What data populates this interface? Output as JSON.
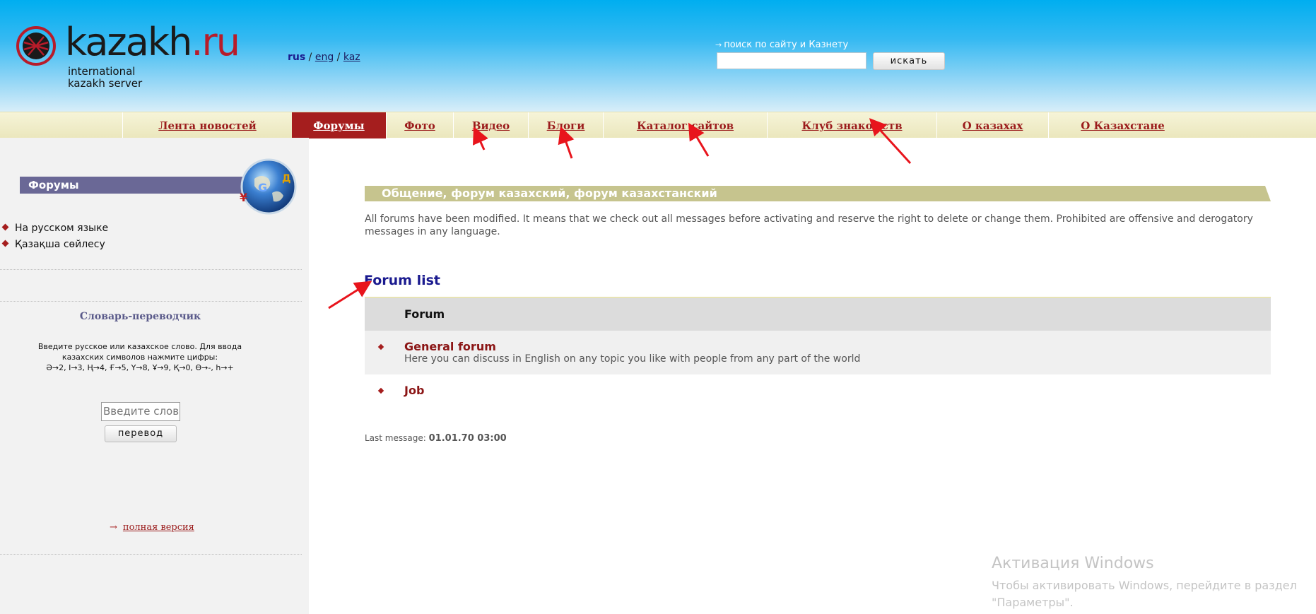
{
  "header": {
    "logo": {
      "word_main": "kazakh",
      "word_accent": ".ru",
      "subtitle_line1": "international",
      "subtitle_line2": "kazakh server"
    },
    "languages": {
      "current": "rus",
      "separator": " / ",
      "eng": "eng",
      "kaz": "kaz"
    },
    "search": {
      "label": "поиск по сайту и Казнету",
      "value": "",
      "button": "искать"
    },
    "colors": {
      "sky_top": "#00aef0",
      "sky_bottom": "#d8eef9"
    }
  },
  "nav": {
    "items": [
      {
        "label": "Лента новостей",
        "active": false
      },
      {
        "label": "Форумы",
        "active": true
      },
      {
        "label": "Фото",
        "active": false
      },
      {
        "label": "Видео",
        "active": false
      },
      {
        "label": "Блоги",
        "active": false
      },
      {
        "label": "Каталог сайтов",
        "active": false
      },
      {
        "label": "Клуб знакомств",
        "active": false
      },
      {
        "label": "О казахах",
        "active": false
      },
      {
        "label": "О Казахстане",
        "active": false
      }
    ],
    "active_color": "#a51e1e",
    "link_color": "#9b1c1c"
  },
  "sidebar": {
    "title": "Форумы",
    "links": [
      "На русском языке",
      "Қазақша сөйлесу"
    ],
    "dictionary": {
      "title": "Словарь-переводчик",
      "instructions_line1": "Введите русское или казахское слово. Для ввода",
      "instructions_line2": "казахских символов нажмите цифры:",
      "instructions_line3": "Ә→2, І→3, Ң→4, Ғ→5, Ү→8, Ұ→9, Қ→0, Ө→-, һ→+",
      "input_placeholder": "Введите слово",
      "button": "перевод"
    },
    "full_version": "полная версия"
  },
  "main": {
    "section_title": "Общение, форум казахский, форум казахстанский",
    "notice": "All forums have been modified. It means that we check out all messages before activating and reserve the right to delete or change them. Prohibited are offensive and derogatory messages in any language.",
    "forum_list_heading": "Forum list",
    "table": {
      "header": "Forum",
      "rows": [
        {
          "name": "General forum",
          "description": "Here you can discuss in English on any topic you like with people from any part of the world"
        },
        {
          "name": "Job",
          "description": ""
        }
      ]
    },
    "last_message_label": "Last message:",
    "last_message_value": "01.01.70 03:00"
  },
  "windows_watermark": {
    "title": "Активация Windows",
    "line1": "Чтобы активировать Windows, перейдите в раздел",
    "line2": "\"Параметры\"."
  },
  "icons": {
    "logo": "kazakh-shanyrak-logo-icon",
    "globe": "globe-icon",
    "bullet": "red-diamond-bullet-icon",
    "arrow": "small-arrow-icon"
  }
}
